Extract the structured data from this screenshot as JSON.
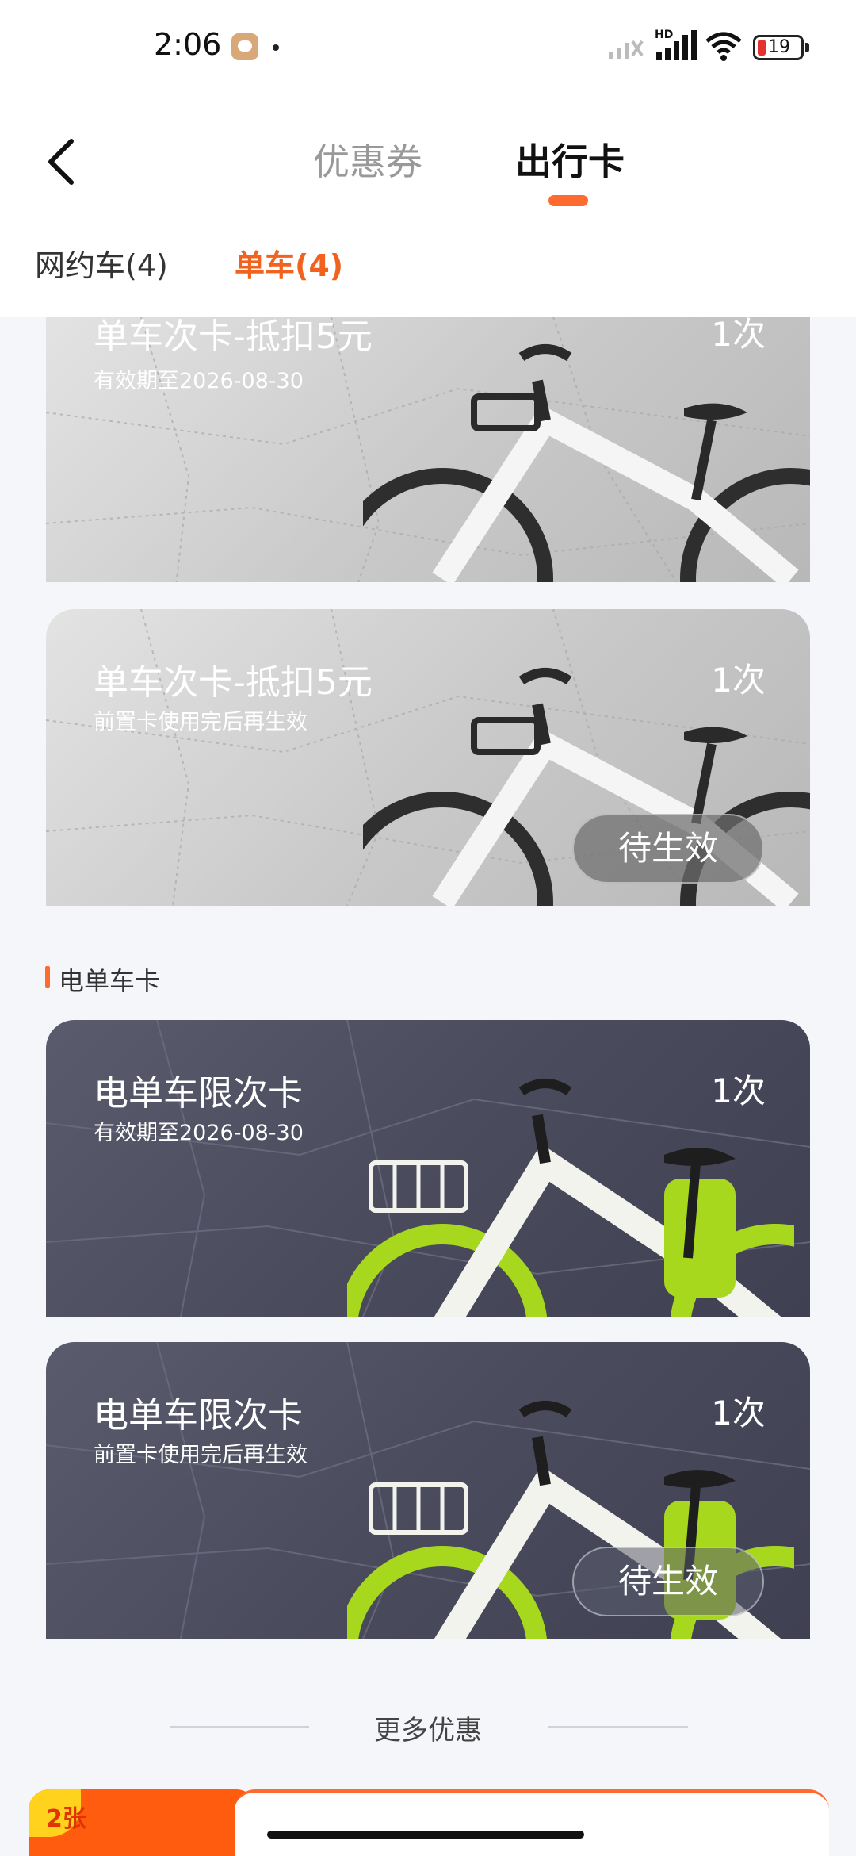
{
  "status_bar": {
    "time": "2:06",
    "network": "HD",
    "battery": "19",
    "icons": [
      "message-icon",
      "signal-icon",
      "wifi-icon",
      "battery-icon"
    ]
  },
  "header": {
    "tabs": [
      {
        "label": "优惠券",
        "active": false
      },
      {
        "label": "出行卡",
        "active": true
      }
    ],
    "accent_color": "#ff6a30"
  },
  "sub_tabs": [
    {
      "label": "网约车(4)",
      "active": false
    },
    {
      "label": "单车(4)",
      "active": true
    }
  ],
  "cards": [
    {
      "title": "单车次卡-抵扣5元",
      "subtitle": "有效期至2026-08-30",
      "count": "1次",
      "kind": "bike"
    },
    {
      "title": "单车次卡-抵扣5元",
      "subtitle": "前置卡使用完后再生效",
      "count": "1次",
      "kind": "bike",
      "badge": "待生效"
    },
    {
      "title": "电单车限次卡",
      "subtitle": "有效期至2026-08-30",
      "count": "1次",
      "kind": "ebike"
    },
    {
      "title": "电单车限次卡",
      "subtitle": "前置卡使用完后再生效",
      "count": "1次",
      "kind": "ebike",
      "badge": "待生效"
    }
  ],
  "section": {
    "title": "电单车卡"
  },
  "more": {
    "label": "更多优惠"
  },
  "promo": {
    "count_label": "2张"
  }
}
